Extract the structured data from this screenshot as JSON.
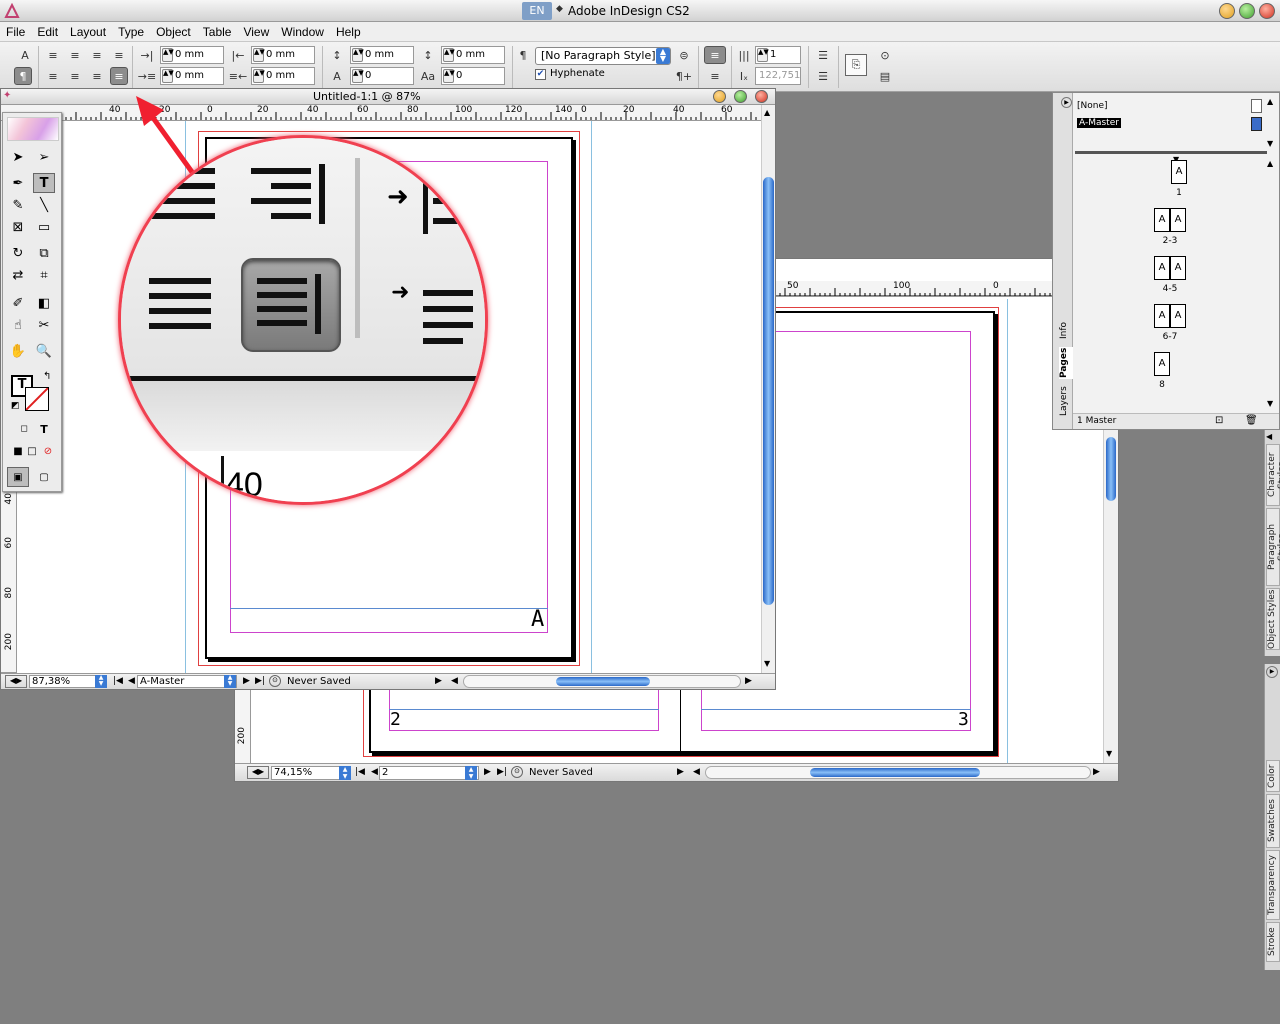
{
  "titlebar": {
    "lang": "EN",
    "title": "Adobe InDesign CS2"
  },
  "menu": [
    "File",
    "Edit",
    "Layout",
    "Type",
    "Object",
    "Table",
    "View",
    "Window",
    "Help"
  ],
  "control": {
    "left_indent": "0 mm",
    "right_indent": "0 mm",
    "first_line_indent": "0 mm",
    "last_line_indent": "0 mm",
    "space_before": "0 mm",
    "space_after": "0 mm",
    "drop_cap_lines": "0",
    "drop_cap_chars": "0",
    "paragraph_style": "[No Paragraph Style]",
    "hyphenate_label": "Hyphenate",
    "columns": "1",
    "column_width": "122,751 n"
  },
  "doc1": {
    "title": "Untitled-1:1 @ 87%",
    "zoom": "87,38%",
    "page": "A-Master",
    "status": "Never Saved",
    "master_letter": "A",
    "ruler_top": [
      "40",
      "20",
      "0",
      "20",
      "40",
      "60",
      "80",
      "100",
      "120",
      "140",
      "0",
      "20",
      "40",
      "60"
    ],
    "ruler_left": [
      "40",
      "60",
      "80",
      "200"
    ]
  },
  "doc2": {
    "zoom": "74,15%",
    "page": "2",
    "status": "Never Saved",
    "page_left_num": "2",
    "page_right_num": "3",
    "ruler_top": [
      "50",
      "100",
      "0"
    ],
    "ruler_left": [
      "200"
    ]
  },
  "magnifier": {
    "ruler_num": "40"
  },
  "pages_panel": {
    "none_label": "[None]",
    "master_label": "A-Master",
    "tabs": [
      "Info",
      "Pages",
      "Layers"
    ],
    "thumbs": [
      {
        "label": "1",
        "pages": [
          "A"
        ]
      },
      {
        "label": "2-3",
        "pages": [
          "A",
          "A"
        ]
      },
      {
        "label": "4-5",
        "pages": [
          "A",
          "A"
        ]
      },
      {
        "label": "6-7",
        "pages": [
          "A",
          "A"
        ]
      },
      {
        "label": "8",
        "pages": [
          "A"
        ]
      }
    ],
    "footer": "1 Master"
  },
  "right_tabs_top": [
    "Character Styles",
    "Paragraph Styles",
    "Object Styles"
  ],
  "right_tabs_bottom": [
    "Color",
    "Swatches",
    "Transparency",
    "Stroke"
  ],
  "colors": {
    "accent": "#3a7ad4",
    "master_swatch": "#3a6cc8",
    "magnifier_border": "#f04050",
    "margin_guide": "#cc44cc",
    "bleed_guide": "#e04040"
  }
}
